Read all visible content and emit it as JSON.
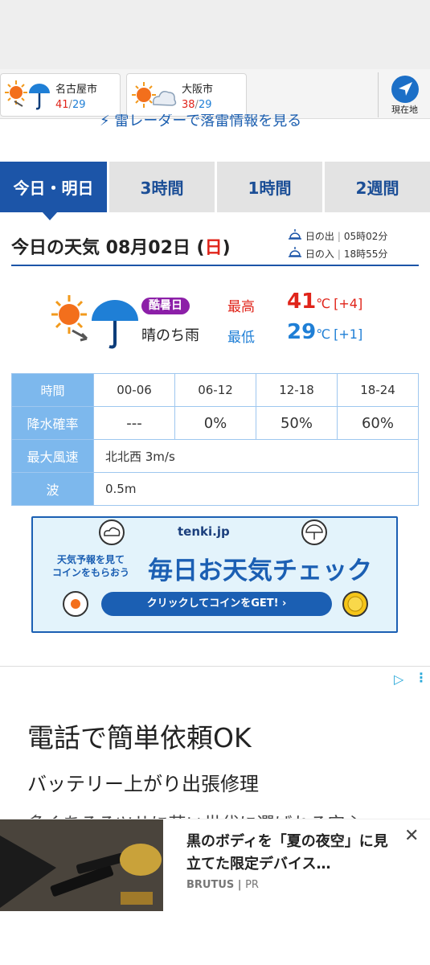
{
  "cities": [
    {
      "name": "名古屋市",
      "high": "41",
      "low": "29",
      "icon": "sunny-then-rain-icon"
    },
    {
      "name": "大阪市",
      "high": "38",
      "low": "29",
      "icon": "sunny-then-cloudy-icon"
    }
  ],
  "location_button": {
    "label": "現在地",
    "icon": "navigation-arrow-icon"
  },
  "radar_link": {
    "text": "雷レーダーで落雷情報を見る",
    "icon": "lightning-icon"
  },
  "tabs": [
    {
      "label": "今日・明日",
      "active": true
    },
    {
      "label": "3時間",
      "active": false
    },
    {
      "label": "1時間",
      "active": false
    },
    {
      "label": "2週間",
      "active": false
    }
  ],
  "today": {
    "title_prefix": "今日の天気 08月02日 (",
    "weekday": "日",
    "title_suffix": ")",
    "sunrise_label": "日の出",
    "sunrise_time": "05時02分",
    "sunset_label": "日の入",
    "sunset_time": "18時55分",
    "badge": "酷暑日",
    "telop": "晴のち雨",
    "high_label": "最高",
    "low_label": "最低",
    "high": "41",
    "low": "29",
    "unit": "℃",
    "high_diff": "[+4]",
    "low_diff": "[+1]"
  },
  "forecast_table": {
    "time_label": "時間",
    "periods": [
      "00-06",
      "06-12",
      "12-18",
      "18-24"
    ],
    "precip_label": "降水確率",
    "precip": [
      "---",
      "0%",
      "50%",
      "60%"
    ],
    "wind_label": "最大風速",
    "wind": "北北西 3m/s",
    "wave_label": "波",
    "wave": "0.5m"
  },
  "banner": {
    "logo": "tenki.jp",
    "small_line1": "天気予報を見て",
    "small_line2": "コインをもらおう",
    "headline": "毎日お天気チェック",
    "cta": "クリックしてコインをGET! ›"
  },
  "ad": {
    "headline": "電話で簡単依頼OK",
    "subhead": "バッテリー上がり出張修理",
    "partial": "多くあるるツサに芸い世代に選ばれる安心"
  },
  "bottom_ad": {
    "title": "黒のボディを「夏の夜空」に見立てた限定デバイス…",
    "source": "BRUTUS",
    "pr": "PR",
    "close": "✕"
  },
  "colors": {
    "accent": "#1c55a8",
    "high": "#e0241a",
    "low": "#1f7fd6",
    "badge": "#8c1fa8"
  }
}
